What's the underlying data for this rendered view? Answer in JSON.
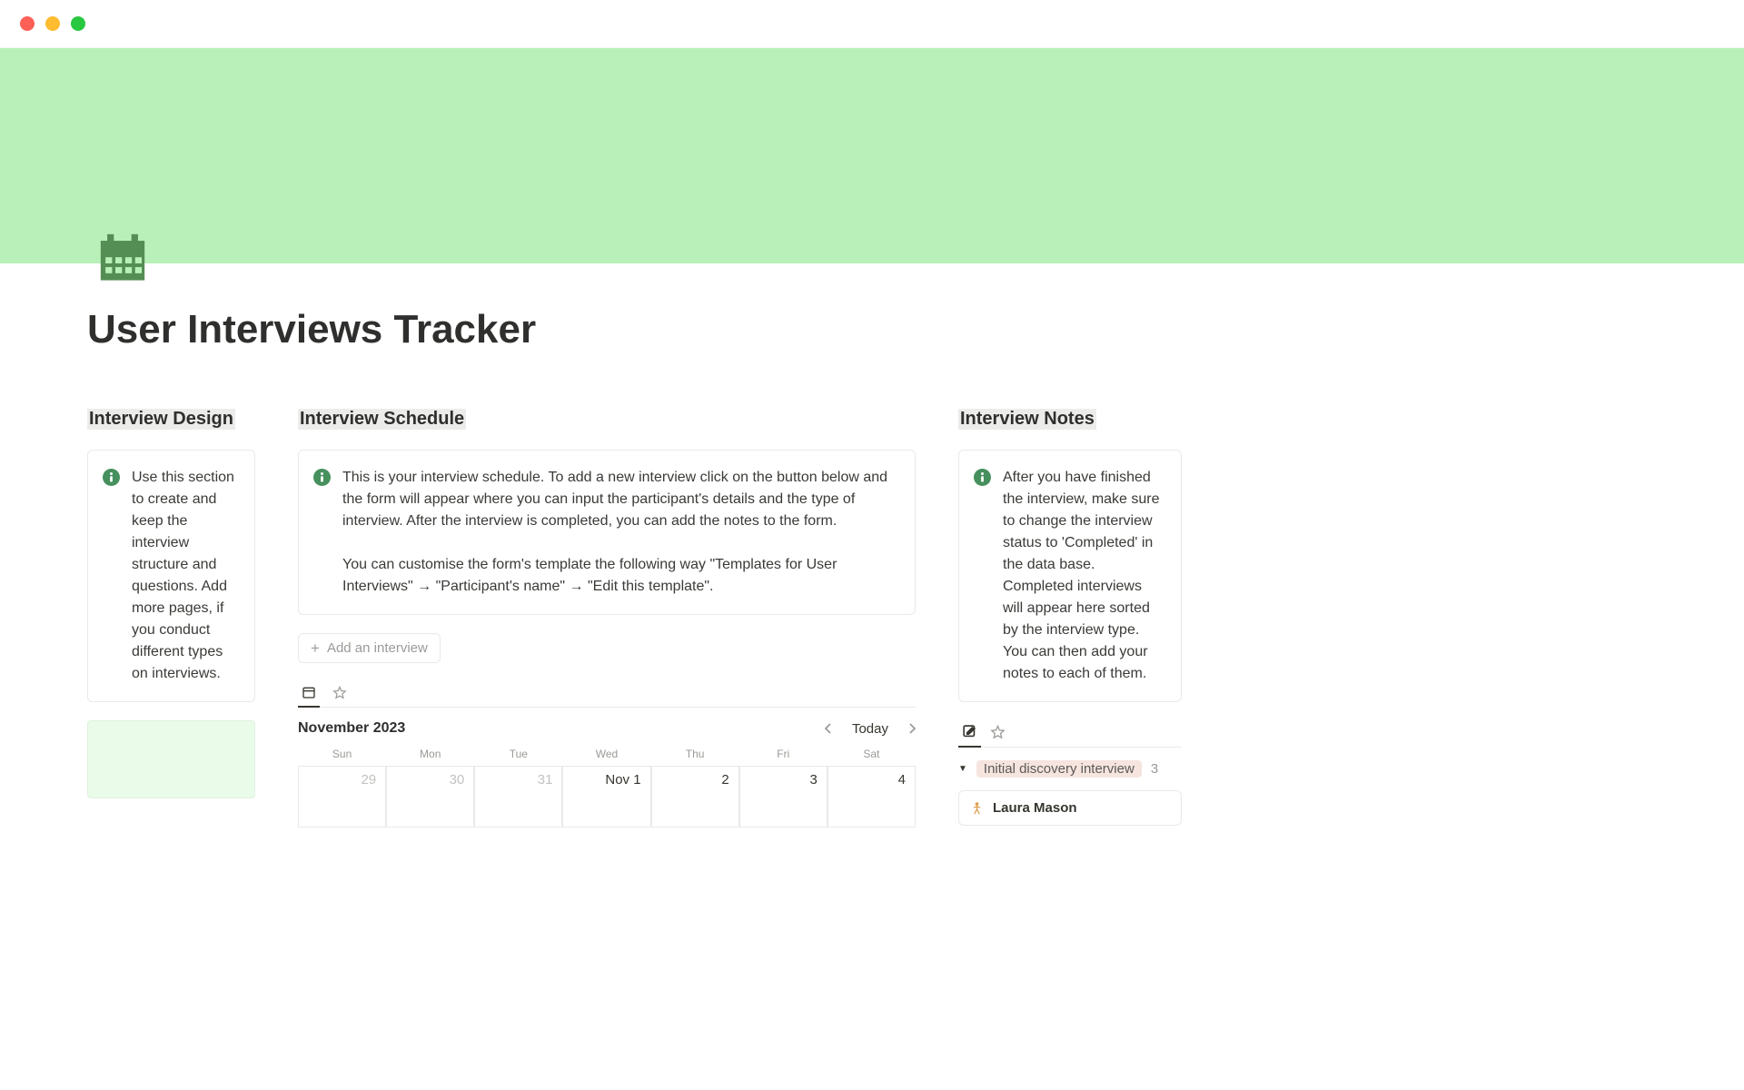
{
  "page": {
    "title": "User Interviews Tracker"
  },
  "sections": {
    "design": {
      "heading": "Interview Design",
      "callout": "Use this section to create and keep the interview structure and questions. Add more pages, if you conduct different types on interviews."
    },
    "schedule": {
      "heading": "Interview Schedule",
      "callout_p1": "This is your interview schedule. To add a new interview click on the button below and the form will appear where you can input the participant's details and the type of interview. After the interview is completed, you can add the notes to the form.",
      "callout_p2": "You can customise the form's template the following way \"Templates for User Interviews\" → \"Participant's name\" → \"Edit this template\".",
      "add_label": "Add an interview",
      "calendar": {
        "month_label": "November 2023",
        "today_label": "Today",
        "days": {
          "0": "Sun",
          "1": "Mon",
          "2": "Tue",
          "3": "Wed",
          "4": "Thu",
          "5": "Fri",
          "6": "Sat"
        },
        "cells": {
          "0": "29",
          "1": "30",
          "2": "31",
          "3": "Nov 1",
          "4": "2",
          "5": "3",
          "6": "4"
        }
      }
    },
    "notes": {
      "heading": "Interview Notes",
      "callout": "After you have finished the interview, make sure to change the interview status to 'Completed' in the data base. Completed interviews will appear here sorted by the interview type. You can then add your notes to each of them.",
      "group": {
        "label": "Initial discovery interview",
        "count": "3"
      },
      "person": {
        "name": "Laura Mason"
      }
    }
  },
  "icons": {
    "page_icon": "calendar-icon",
    "info": "info-icon"
  },
  "colors": {
    "banner": "#b9f0b9",
    "accent_green": "#508f50"
  }
}
